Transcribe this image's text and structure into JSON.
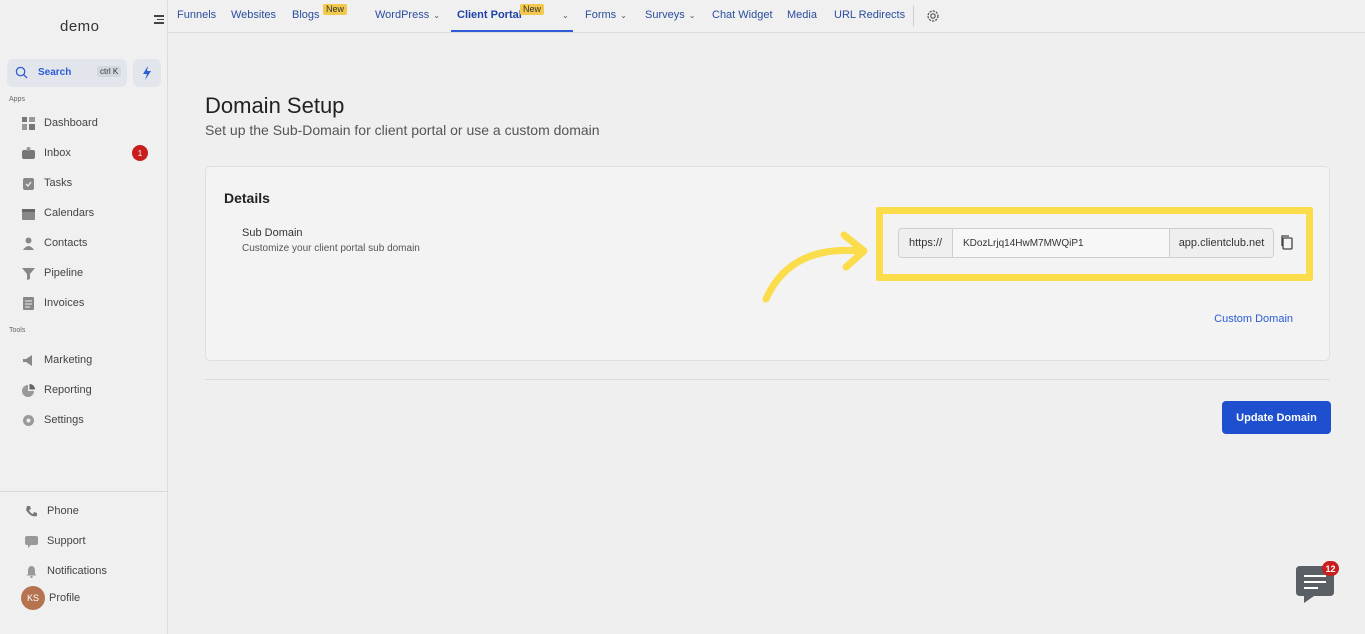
{
  "sidebar": {
    "logo": "demo",
    "search_label": "Search",
    "search_shortcut": "ctrl K",
    "apps_label": "Apps",
    "tools_label": "Tools",
    "apps": [
      {
        "label": "Dashboard",
        "icon": "dashboard-icon"
      },
      {
        "label": "Inbox",
        "icon": "inbox-icon",
        "badge": "1"
      },
      {
        "label": "Tasks",
        "icon": "tasks-icon"
      },
      {
        "label": "Calendars",
        "icon": "calendar-icon"
      },
      {
        "label": "Contacts",
        "icon": "contacts-icon"
      },
      {
        "label": "Pipeline",
        "icon": "pipeline-icon"
      },
      {
        "label": "Invoices",
        "icon": "invoice-icon"
      }
    ],
    "tools": [
      {
        "label": "Marketing",
        "icon": "megaphone-icon"
      },
      {
        "label": "Reporting",
        "icon": "chart-icon"
      },
      {
        "label": "Settings",
        "icon": "gear-icon"
      }
    ],
    "bottom": [
      {
        "label": "Phone",
        "icon": "phone-icon"
      },
      {
        "label": "Support",
        "icon": "support-icon"
      },
      {
        "label": "Notifications",
        "icon": "bell-icon"
      },
      {
        "label": "Profile",
        "avatar": "KS"
      }
    ]
  },
  "topbar": {
    "tabs": [
      {
        "label": "Funnels"
      },
      {
        "label": "Websites"
      },
      {
        "label": "Blogs",
        "badge": "New"
      },
      {
        "label": "WordPress"
      },
      {
        "label": "Client Portal",
        "badge": "New"
      },
      {
        "label": "Forms"
      },
      {
        "label": "Surveys"
      },
      {
        "label": "Chat Widget"
      },
      {
        "label": "Media"
      },
      {
        "label": "URL Redirects"
      }
    ],
    "active_tab": "Client Portal"
  },
  "main": {
    "title": "Domain Setup",
    "subtitle": "Set up the Sub-Domain for client portal or use a custom domain",
    "card": {
      "title": "Details",
      "field_title": "Sub Domain",
      "field_desc": "Customize your client portal sub domain",
      "prefix": "https://",
      "subdomain_value": "KDozLrjq14HwM7MWQiP1",
      "suffix": "app.clientclub.net",
      "custom_domain_link": "Custom Domain"
    },
    "update_button": "Update Domain"
  },
  "chat_widget": {
    "badge": "12"
  },
  "colors": {
    "accent": "#1d4fcf",
    "highlight": "#fbdc4b",
    "badge": "#c81e1e"
  }
}
